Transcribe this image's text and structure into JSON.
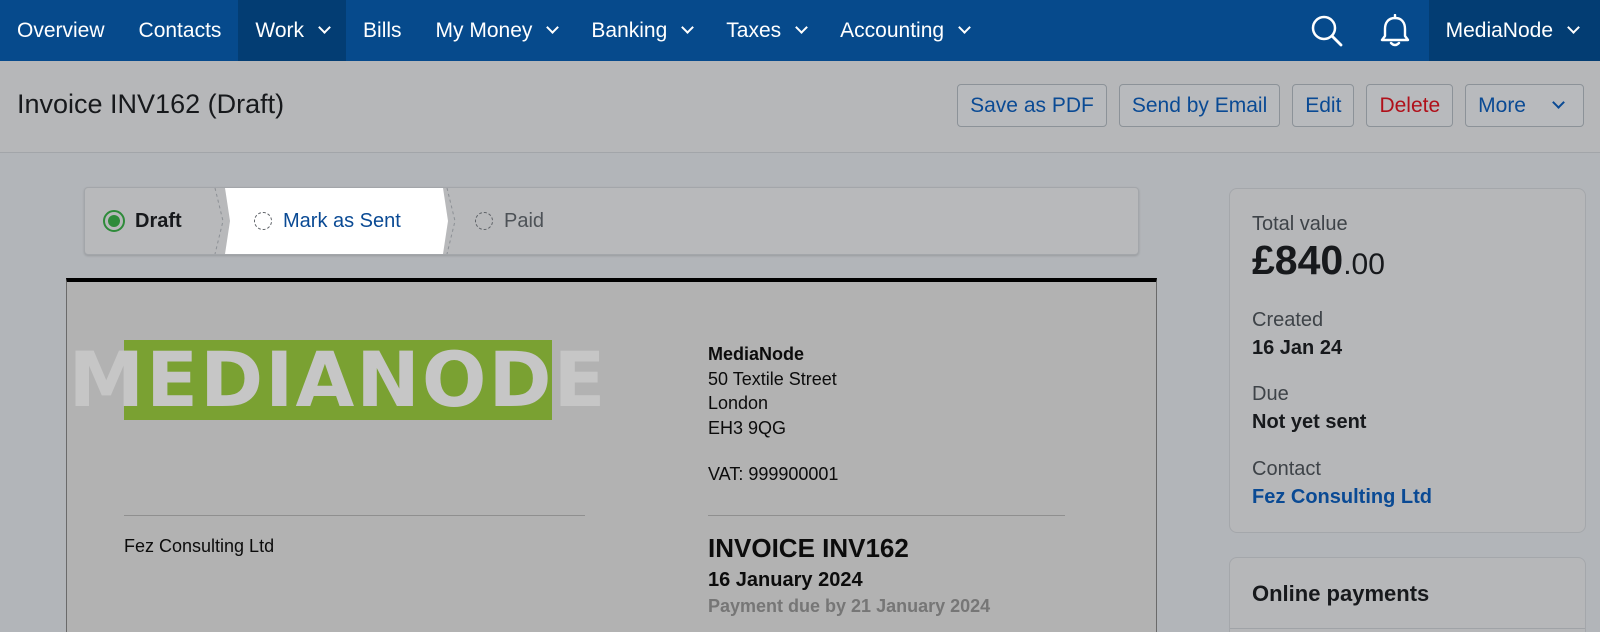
{
  "nav": {
    "items": [
      {
        "label": "Overview",
        "dropdown": false,
        "active": false
      },
      {
        "label": "Contacts",
        "dropdown": false,
        "active": false
      },
      {
        "label": "Work",
        "dropdown": true,
        "active": true
      },
      {
        "label": "Bills",
        "dropdown": false,
        "active": false
      },
      {
        "label": "My Money",
        "dropdown": true,
        "active": false
      },
      {
        "label": "Banking",
        "dropdown": true,
        "active": false
      },
      {
        "label": "Taxes",
        "dropdown": true,
        "active": false
      },
      {
        "label": "Accounting",
        "dropdown": true,
        "active": false
      }
    ],
    "account": "MediaNode",
    "icons": [
      "search-icon",
      "bell-icon"
    ]
  },
  "header": {
    "title": "Invoice INV162 (Draft)",
    "actions": {
      "save_pdf": "Save as PDF",
      "send_email": "Send by Email",
      "edit": "Edit",
      "delete": "Delete",
      "more": "More"
    }
  },
  "status": {
    "steps": [
      {
        "label": "Draft",
        "state": "complete"
      },
      {
        "label": "Mark as Sent",
        "state": "current"
      },
      {
        "label": "Paid",
        "state": "pending"
      }
    ]
  },
  "invoice": {
    "logo_text": "MEDIANODE",
    "company": {
      "name": "MediaNode",
      "address": [
        "50 Textile Street",
        "London",
        "EH3 9QG"
      ],
      "vat": "VAT: 999900001"
    },
    "client": "Fez Consulting Ltd",
    "title": "INVOICE INV162",
    "date": "16 January 2024",
    "due": "Payment due by 21 January 2024"
  },
  "summary": {
    "total_label": "Total value",
    "total_major": "£840",
    "total_minor": ".00",
    "created_label": "Created",
    "created_value": "16 Jan 24",
    "due_label": "Due",
    "due_value": "Not yet sent",
    "contact_label": "Contact",
    "contact_value": "Fez Consulting Ltd"
  },
  "payments": {
    "title": "Online payments"
  },
  "colors": {
    "nav_bg": "#064a8c",
    "link": "#0a4a94",
    "danger": "#b0101a",
    "draft_green": "#2e8b3a",
    "logo_green": "#7aa132"
  }
}
